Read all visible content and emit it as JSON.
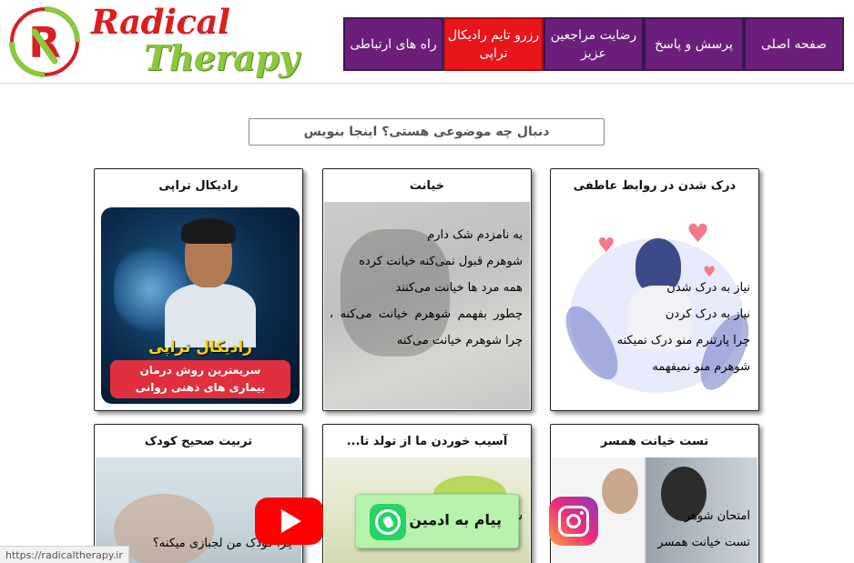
{
  "brand": {
    "line1": "Radical",
    "line2": "Therapy",
    "emblem_letter": "R",
    "emblem_text": "RADICAL THERAPY",
    "colors": {
      "red": "#d91f1f",
      "green": "#8dc63f"
    }
  },
  "nav": {
    "items": [
      {
        "label": "صفحه اصلی",
        "variant": "purple"
      },
      {
        "label": "پرسش و پاسخ",
        "variant": "purple"
      },
      {
        "label": "رضایت مراجعین عزیز",
        "variant": "purple"
      },
      {
        "label": "رزرو تایم رادیکال تراپی",
        "variant": "red"
      },
      {
        "label": "راه های ارتباطی",
        "variant": "purple"
      }
    ],
    "colors": {
      "purple": "#6b1f7b",
      "red": "#e8161a"
    }
  },
  "search": {
    "placeholder": "دنبال چه موضوعی هستی؟ اینجا بنویس"
  },
  "cards": [
    {
      "title": "درک شدن در روابط عاطفی",
      "lines": [
        "نیاز به درک شدن",
        "نیاز به درک کردن",
        "چرا پارتنرم منو درک نمیکنه",
        "شوهرم منو نمیفهمه"
      ]
    },
    {
      "title": "خیانت",
      "lines": [
        "به نامزدم شک دارم",
        "شوهرم قبول نمی‌کنه خیانت کرده",
        "همه مرد ها خیانت می‌کنند",
        "چطور بفهمم شوهرم خیانت می‌کنه ، چرا شوهرم خیانت می‌کنه"
      ]
    },
    {
      "title": "رادیکال تراپی",
      "promo_title": "رادیکال تراپی",
      "promo_line1": "سریعترین روش درمان",
      "promo_line2": "بیماری های ذهنی روانی"
    },
    {
      "title": "تست خیانت همسر",
      "lines": [
        "امتحان شوهر",
        "تست خیانت همسر"
      ]
    },
    {
      "title": "آسیب خوردن ما از تولد تا...",
      "lines": [
        "ش"
      ]
    },
    {
      "title": "تربیت صحیح کودک",
      "lines": [
        "چرا کودک من لجبازی میکنه؟"
      ]
    }
  ],
  "floating": {
    "whatsapp_label": "پیام به ادمین",
    "whatsapp_color": "#25d366",
    "youtube_color": "#ff0000",
    "instagram_icon": "instagram-icon"
  },
  "status_url": "https://radicaltherapy.ir"
}
